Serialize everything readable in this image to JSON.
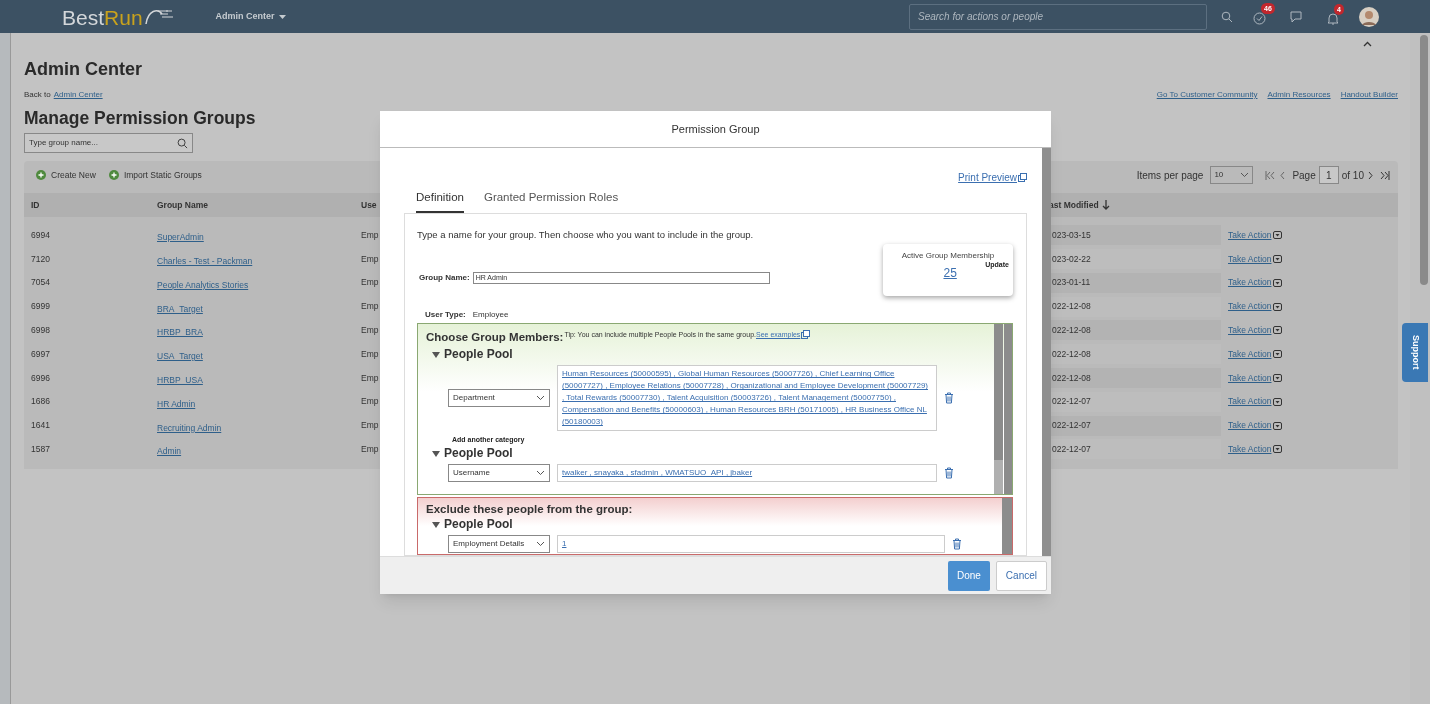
{
  "header": {
    "logo_first": "Best",
    "logo_second": "Run",
    "menu": "Admin Center",
    "search": {
      "placeholder": "Search for actions or people"
    },
    "todo_count": "46",
    "notification_count": "4"
  },
  "page": {
    "title": "Admin Center",
    "back_prefix": "Back to",
    "back_link": "Admin Center",
    "links": [
      "Go To Customer Community",
      "Admin Resources",
      "Handout Builder"
    ],
    "heading": "Manage Permission Groups",
    "search": {
      "placeholder": "Type group name..."
    }
  },
  "toolbar": {
    "actions": [
      "Create New",
      "Import Static Groups"
    ],
    "items_per_page_label": "Items per page",
    "items_per_page": "10",
    "page_label": "Page",
    "page": "1",
    "page_total": "of 10"
  },
  "table": {
    "columns": [
      {
        "label": "ID",
        "sorted": false
      },
      {
        "label": "Group Name",
        "sorted": false
      },
      {
        "label": "Use",
        "sorted": false
      },
      {
        "label": "ast Modified",
        "sorted": true
      }
    ],
    "rows": [
      {
        "id": "6994",
        "name": "SuperAdmin",
        "user_type": "Emp",
        "modified": "023-03-15",
        "action": "Take Action"
      },
      {
        "id": "7120",
        "name": "Charles - Test - Packman",
        "user_type": "Emp",
        "modified": "023-02-22",
        "action": "Take Action"
      },
      {
        "id": "7054",
        "name": "People Analytics Stories",
        "user_type": "Emp",
        "modified": "023-01-11",
        "action": "Take Action"
      },
      {
        "id": "6999",
        "name": "BRA_Target",
        "user_type": "Emp",
        "modified": "022-12-08",
        "action": "Take Action"
      },
      {
        "id": "6998",
        "name": "HRBP_BRA",
        "user_type": "Emp",
        "modified": "022-12-08",
        "action": "Take Action"
      },
      {
        "id": "6997",
        "name": "USA_Target",
        "user_type": "Emp",
        "modified": "022-12-08",
        "action": "Take Action"
      },
      {
        "id": "6996",
        "name": "HRBP_USA",
        "user_type": "Emp",
        "modified": "022-12-08",
        "action": "Take Action"
      },
      {
        "id": "1686",
        "name": "HR Admin",
        "user_type": "Emp",
        "modified": "022-12-07",
        "action": "Take Action"
      },
      {
        "id": "1641",
        "name": "Recruiting Admin",
        "user_type": "Emp",
        "modified": "022-12-07",
        "action": "Take Action"
      },
      {
        "id": "1587",
        "name": "Admin",
        "user_type": "Emp",
        "modified": "022-12-07",
        "action": "Take Action"
      }
    ]
  },
  "support": "Support",
  "dialog": {
    "title": "Permission Group",
    "print_preview": "Print Preview",
    "tabs": [
      {
        "label": "Definition",
        "selected": true
      },
      {
        "label": "Granted Permission Roles",
        "selected": false
      }
    ],
    "intro": "Type a name for your group. Then choose who you want to include in the group.",
    "group_name_label": "Group Name:",
    "group_name": "HR Admin",
    "membership": {
      "label": "Active Group Membership",
      "update": "Update",
      "count": "25"
    },
    "user_type_label": "User Type:",
    "user_type": "Employee",
    "include": {
      "title": "Choose Group Members:",
      "tip": "Tip: You can include multiple People Pools in the same group.",
      "tip_link": "See examples",
      "pools": [
        {
          "title": "People Pool",
          "expanded": true,
          "category": "Department",
          "values": "Human Resources (50000595) , Global Human Resources (50007726) , Chief Learning Office (50007727) , Employee Relations (50007728) , Organizational and Employee Development (50007729) , Total Rewards (50007730) , Talent Acquisition (50003726) , Talent Management (50007750) , Compensation and Benefits (50000603) , Human Resources BRH (50171005) , HR Business Office NL (50180003)",
          "add_category": "Add another category"
        },
        {
          "title": "People Pool",
          "expanded": true,
          "category": "Username",
          "values": "twalker , snayaka , sfadmin , WMATSUO_API , jbaker"
        }
      ]
    },
    "exclude": {
      "title": "Exclude these people from the group:",
      "pools": [
        {
          "title": "People Pool",
          "expanded": true,
          "category": "Employment Details",
          "values": "1"
        }
      ]
    },
    "buttons": [
      {
        "label": "Done",
        "kind": "primary"
      },
      {
        "label": "Cancel",
        "kind": "secondary"
      }
    ]
  }
}
